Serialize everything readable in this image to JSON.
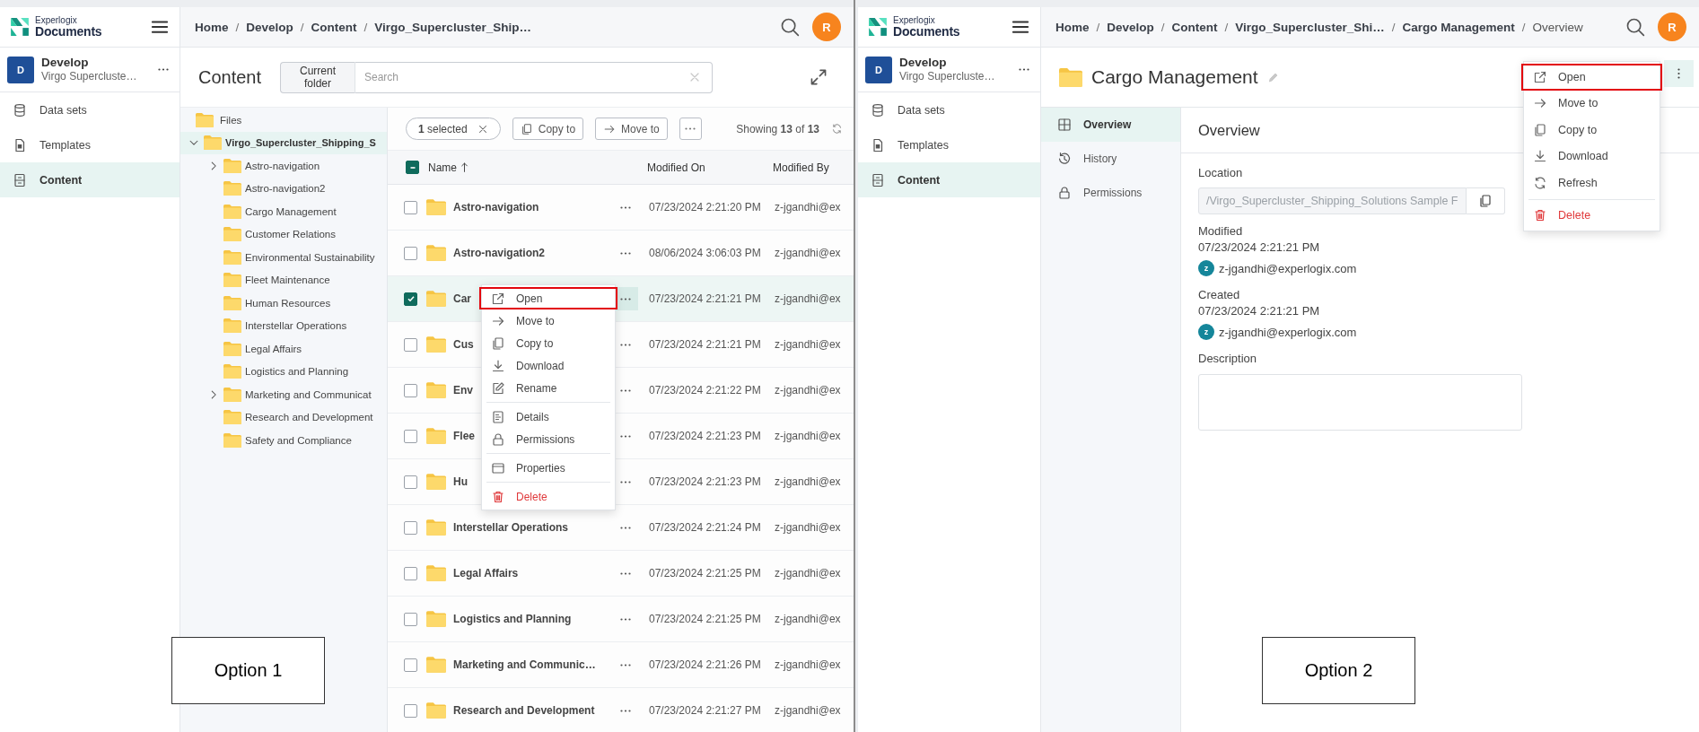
{
  "panels": [
    {
      "kind": "file_browser",
      "logo": {
        "brand": "Experlogix",
        "product": "Documents"
      },
      "workspace": {
        "initial": "D",
        "name": "Develop",
        "subtitle": "Virgo Supercluste…"
      },
      "nav": [
        {
          "kind": "datasets",
          "label": "Data sets",
          "selected": false
        },
        {
          "kind": "templates",
          "label": "Templates",
          "selected": false
        },
        {
          "kind": "content",
          "label": "Content",
          "selected": true
        }
      ],
      "breadcrumb": {
        "separator": "/",
        "items": [
          {
            "label": "Home",
            "current": false
          },
          {
            "label": "Develop",
            "current": false
          },
          {
            "label": "Content",
            "current": false
          },
          {
            "label": "Virgo_Supercluster_Ship…",
            "current": false
          }
        ]
      },
      "user_initial": "R",
      "title": "Content",
      "search": {
        "scope": "Current folder",
        "placeholder": "Search"
      },
      "tree": {
        "label": "Files",
        "children": [
          {
            "label": "Virgo_Supercluster_Shipping_S",
            "expanded": true,
            "selected": true,
            "children": [
              {
                "label": "Astro-navigation",
                "expandable": true
              },
              {
                "label": "Astro-navigation2",
                "expandable": false
              },
              {
                "label": "Cargo Management",
                "expandable": false
              },
              {
                "label": "Customer Relations",
                "expandable": false
              },
              {
                "label": "Environmental Sustainability",
                "expandable": false
              },
              {
                "label": "Fleet Maintenance",
                "expandable": false
              },
              {
                "label": "Human Resources",
                "expandable": false
              },
              {
                "label": "Interstellar Operations",
                "expandable": false
              },
              {
                "label": "Legal Affairs",
                "expandable": false
              },
              {
                "label": "Logistics and Planning",
                "expandable": false
              },
              {
                "label": "Marketing and Communicat",
                "expandable": true
              },
              {
                "label": "Research and Development",
                "expandable": false
              },
              {
                "label": "Safety and Compliance",
                "expandable": false
              }
            ]
          }
        ]
      },
      "toolbar": {
        "selection": "**1** selected",
        "copy": "Copy to",
        "move": "Move to",
        "count": "Showing **13** of **13**"
      },
      "table": {
        "partially_checked": true,
        "columns": [
          {
            "label": "Name",
            "sorted": true
          },
          {
            "label": "Modified On",
            "sorted": false
          },
          {
            "label": "Modified By",
            "sorted": false
          }
        ],
        "rows": [
          {
            "name": "Astro-navigation",
            "modified_on": "07/23/2024 2:21:20 PM",
            "modified_by": "z-jgandhi@ex",
            "checked": false,
            "selected": false,
            "menu_open": false
          },
          {
            "name": "Astro-navigation2",
            "modified_on": "08/06/2024 3:06:03 PM",
            "modified_by": "z-jgandhi@ex",
            "checked": false,
            "selected": false,
            "menu_open": false
          },
          {
            "name": "Car",
            "modified_on": "07/23/2024 2:21:21 PM",
            "modified_by": "z-jgandhi@ex",
            "checked": true,
            "selected": true,
            "menu_open": true
          },
          {
            "name": "Cus",
            "modified_on": "07/23/2024 2:21:21 PM",
            "modified_by": "z-jgandhi@ex",
            "checked": false,
            "selected": false,
            "menu_open": false
          },
          {
            "name": "Env",
            "modified_on": "07/23/2024 2:21:22 PM",
            "modified_by": "z-jgandhi@ex",
            "checked": false,
            "selected": false,
            "menu_open": false
          },
          {
            "name": "Flee",
            "modified_on": "07/23/2024 2:21:23 PM",
            "modified_by": "z-jgandhi@ex",
            "checked": false,
            "selected": false,
            "menu_open": false
          },
          {
            "name": "Hu",
            "modified_on": "07/23/2024 2:21:23 PM",
            "modified_by": "z-jgandhi@ex",
            "checked": false,
            "selected": false,
            "menu_open": false
          },
          {
            "name": "Interstellar Operations",
            "modified_on": "07/23/2024 2:21:24 PM",
            "modified_by": "z-jgandhi@ex",
            "checked": false,
            "selected": false,
            "menu_open": false
          },
          {
            "name": "Legal Affairs",
            "modified_on": "07/23/2024 2:21:25 PM",
            "modified_by": "z-jgandhi@ex",
            "checked": false,
            "selected": false,
            "menu_open": false
          },
          {
            "name": "Logistics and Planning",
            "modified_on": "07/23/2024 2:21:25 PM",
            "modified_by": "z-jgandhi@ex",
            "checked": false,
            "selected": false,
            "menu_open": false
          },
          {
            "name": "Marketing and Communic…",
            "modified_on": "07/23/2024 2:21:26 PM",
            "modified_by": "z-jgandhi@ex",
            "checked": false,
            "selected": false,
            "menu_open": false
          },
          {
            "name": "Research and Development",
            "modified_on": "07/23/2024 2:21:27 PM",
            "modified_by": "z-jgandhi@ex",
            "checked": false,
            "selected": false,
            "menu_open": false
          }
        ]
      },
      "context_menu": [
        {
          "kind": "open",
          "label": "Open",
          "highlighted": true
        },
        {
          "kind": "move",
          "label": "Move to",
          "highlighted": false
        },
        {
          "kind": "copy",
          "label": "Copy to",
          "highlighted": false
        },
        {
          "kind": "download",
          "label": "Download",
          "highlighted": false
        },
        {
          "kind": "rename",
          "label": "Rename",
          "highlighted": false
        },
        {
          "kind": "separator"
        },
        {
          "kind": "details",
          "label": "Details",
          "highlighted": false
        },
        {
          "kind": "permissions",
          "label": "Permissions",
          "highlighted": false
        },
        {
          "kind": "separator"
        },
        {
          "kind": "properties",
          "label": "Properties",
          "highlighted": false
        },
        {
          "kind": "separator"
        },
        {
          "kind": "delete",
          "label": "Delete",
          "highlighted": false
        }
      ],
      "annotation": "Option 1"
    },
    {
      "kind": "folder_details",
      "logo": {
        "brand": "Experlogix",
        "product": "Documents"
      },
      "workspace": {
        "initial": "D",
        "name": "Develop",
        "subtitle": "Virgo Supercluste…"
      },
      "nav": [
        {
          "kind": "datasets",
          "label": "Data sets",
          "selected": false
        },
        {
          "kind": "templates",
          "label": "Templates",
          "selected": false
        },
        {
          "kind": "content",
          "label": "Content",
          "selected": true
        }
      ],
      "breadcrumb": {
        "separator": "/",
        "items": [
          {
            "label": "Home",
            "current": false
          },
          {
            "label": "Develop",
            "current": false
          },
          {
            "label": "Content",
            "current": false
          },
          {
            "label": "Virgo_Supercluster_Shi…",
            "current": false
          },
          {
            "label": "Cargo Management",
            "current": false
          },
          {
            "label": "Overview",
            "current": true
          }
        ]
      },
      "user_initial": "R",
      "title": "Cargo Management",
      "menu_open": true,
      "tabs": [
        {
          "kind": "overview",
          "label": "Overview",
          "selected": true
        },
        {
          "kind": "history",
          "label": "History",
          "selected": false
        },
        {
          "kind": "permissions",
          "label": "Permissions",
          "selected": false
        }
      ],
      "section_title": "Overview",
      "location": {
        "label": "Location",
        "value": "/Virgo_Supercluster_Shipping_Solutions Sample F"
      },
      "modified": {
        "label": "Modified",
        "date": "07/23/2024 2:21:21 PM",
        "user_initial": "z",
        "user": "z-jgandhi@experlogix.com"
      },
      "created": {
        "label": "Created",
        "date": "07/23/2024 2:21:21 PM",
        "user_initial": "z",
        "user": "z-jgandhi@experlogix.com"
      },
      "description": {
        "label": "Description"
      },
      "context_menu": [
        {
          "kind": "open",
          "label": "Open",
          "highlighted": true
        },
        {
          "kind": "move",
          "label": "Move to",
          "highlighted": false
        },
        {
          "kind": "copy",
          "label": "Copy to",
          "highlighted": false
        },
        {
          "kind": "download",
          "label": "Download",
          "highlighted": false
        },
        {
          "kind": "refresh",
          "label": "Refresh",
          "highlighted": false
        },
        {
          "kind": "separator"
        },
        {
          "kind": "delete",
          "label": "Delete",
          "highlighted": false
        }
      ],
      "annotation": "Option 2"
    }
  ]
}
